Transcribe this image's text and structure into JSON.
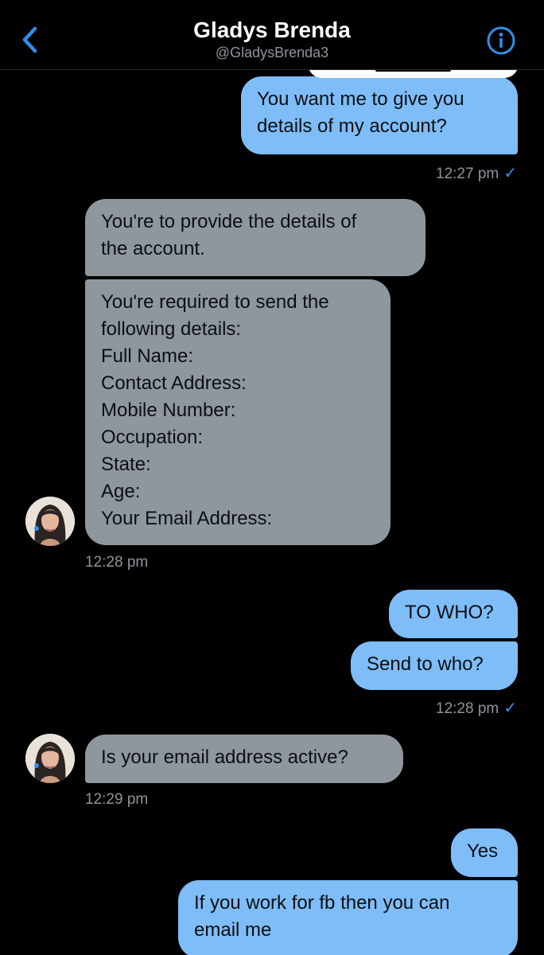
{
  "header": {
    "back_icon": "chevron-left-icon",
    "name": "Gladys Brenda",
    "handle": "@GladysBrenda3",
    "info_icon": "info-icon",
    "accent": "#2f8fe8"
  },
  "messages": [
    {
      "from": "me",
      "text": "You want me to give you\ndetails of my account?"
    },
    {
      "from": "them",
      "text": "You're to provide the details of\nthe account."
    },
    {
      "from": "them",
      "text": "You're required to send the\nfollowing details:\nFull Name:\nContact Address:\nMobile Number:\nOccupation:\nState:\nAge:\nYour Email Address:"
    },
    {
      "from": "me",
      "text": "TO WHO?"
    },
    {
      "from": "me",
      "text": "Send to who?"
    },
    {
      "from": "them",
      "text": "Is your email address active?"
    },
    {
      "from": "me",
      "text": "Yes"
    },
    {
      "from": "me",
      "text": "If you work for fb then you can\nemail me"
    }
  ],
  "timestamps": [
    {
      "text": "12:27 pm",
      "read": true
    },
    {
      "text": "12:28 pm",
      "read": false
    },
    {
      "text": "12:28 pm",
      "read": true
    },
    {
      "text": "12:29 pm",
      "read": false
    }
  ],
  "read_icon": "checkmark-icon",
  "colors": {
    "sent_bubble": "#7ebdf8",
    "received_bubble": "#8f969e",
    "background": "#000000",
    "timestamp": "#8f959b",
    "check": "#3d8fe3"
  }
}
